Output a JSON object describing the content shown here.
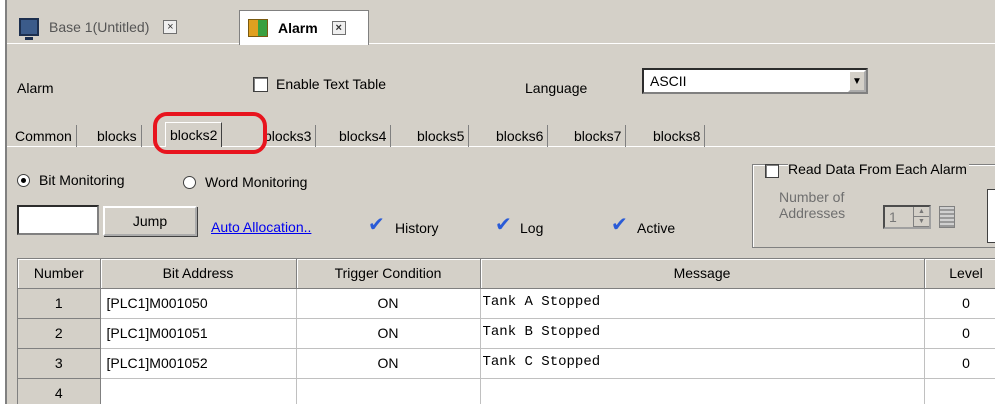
{
  "doc_tabs": [
    {
      "label": "Base 1(Untitled)",
      "icon": "monitor-icon",
      "active": false
    },
    {
      "label": "Alarm",
      "icon": "alarm-icon",
      "active": true
    }
  ],
  "settings": {
    "alarm_label": "Alarm",
    "enable_text_table_label": "Enable Text Table",
    "enable_text_table_checked": false,
    "language_label": "Language",
    "language_value": "ASCII"
  },
  "sub_tabs": [
    "Common",
    "blocks",
    "blocks2",
    "blocks3",
    "blocks4",
    "blocks5",
    "blocks6",
    "blocks7",
    "blocks8"
  ],
  "active_sub_tab": "blocks2",
  "monitoring": {
    "bit_label": "Bit Monitoring",
    "word_label": "Word Monitoring",
    "selected": "bit"
  },
  "toolbar": {
    "jump_value": "",
    "jump_label": "Jump",
    "auto_allocation_label": "Auto Allocation..",
    "history_label": "History",
    "log_label": "Log",
    "active_label": "Active"
  },
  "read_data": {
    "label": "Read Data From Each Alarm",
    "checked": false,
    "number_of_addresses_label_1": "Number of",
    "number_of_addresses_label_2": "Addresses",
    "number_value": "1"
  },
  "table": {
    "headers": [
      "Number",
      "Bit Address",
      "Trigger Condition",
      "Message",
      "Level"
    ],
    "rows": [
      {
        "number": "1",
        "bit_address": "[PLC1]M001050",
        "trigger": "ON",
        "message": "Tank A Stopped",
        "level": "0"
      },
      {
        "number": "2",
        "bit_address": "[PLC1]M001051",
        "trigger": "ON",
        "message": "Tank B Stopped",
        "level": "0"
      },
      {
        "number": "3",
        "bit_address": "[PLC1]M001052",
        "trigger": "ON",
        "message": "Tank C Stopped",
        "level": "0"
      },
      {
        "number": "4",
        "bit_address": "",
        "trigger": "",
        "message": "",
        "level": ""
      }
    ]
  },
  "colors": {
    "accent_check": "#2a5bd7",
    "highlight_ring": "#e8141e",
    "link": "#0000ee"
  }
}
